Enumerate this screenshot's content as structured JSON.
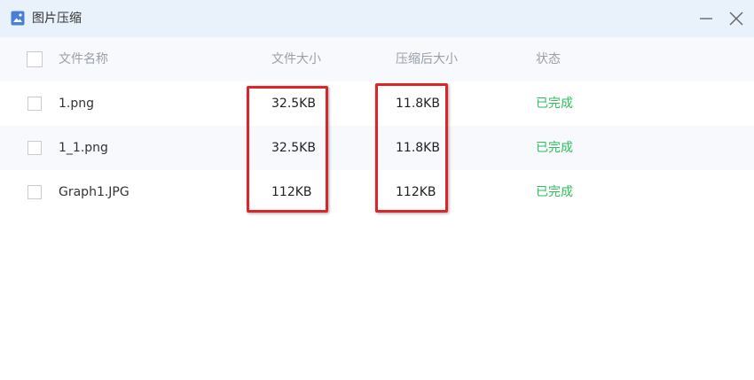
{
  "window": {
    "title": "图片压缩",
    "icons": {
      "app": "image-app-icon",
      "minimize": "minimize-icon",
      "close": "close-icon"
    }
  },
  "table": {
    "headers": {
      "name": "文件名称",
      "size": "文件大小",
      "compressed_size": "压缩后大小",
      "status": "状态"
    },
    "rows": [
      {
        "name": "1.png",
        "size": "32.5KB",
        "compressed_size": "11.8KB",
        "status": "已完成"
      },
      {
        "name": "1_1.png",
        "size": "32.5KB",
        "compressed_size": "11.8KB",
        "status": "已完成"
      },
      {
        "name": "Graph1.JPG",
        "size": "112KB",
        "compressed_size": "112KB",
        "status": "已完成"
      }
    ]
  },
  "colors": {
    "titlebar_bg": "#e9f1fb",
    "status_done": "#2dbf5a",
    "highlight_border": "#d9262a"
  }
}
